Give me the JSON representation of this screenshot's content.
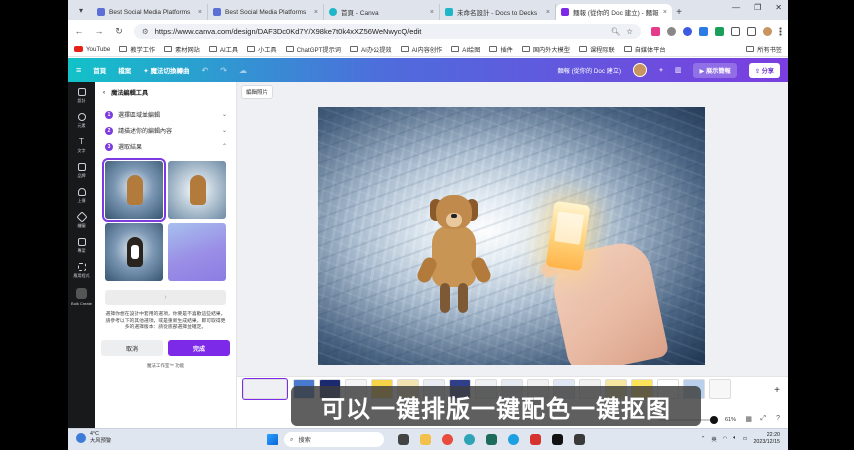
{
  "browser": {
    "tabs": [
      {
        "title": "Best Social Media Platforms",
        "color": "#5b6fd6"
      },
      {
        "title": "Best Social Media Platforms",
        "color": "#5b6fd6"
      },
      {
        "title": "首頁 - Canva",
        "color": "#1fb6c8"
      },
      {
        "title": "未命名設計 - Docs to Decks",
        "color": "#1fb6c8"
      },
      {
        "title": "麵報 (從你的 Doc 建立) - 麵報",
        "color": "#7d2ae8",
        "active": true
      }
    ],
    "url": "https://www.canva.com/design/DAF3Dc0Kd7Y/X98ke7t0k4xXZ56WeNwycQ/edit",
    "bookmarks": [
      "YouTube",
      "教学工作",
      "素材网站",
      "AI工具",
      "小工具",
      "ChatGPT提示词",
      "AI办公提效",
      "AI内容创作",
      "AI绘图",
      "插件",
      "国内外大模型",
      "课程际联",
      "自媒体平台"
    ],
    "bookmarks_right": "所有书签"
  },
  "canva_header": {
    "home": "首頁",
    "file": "檔案",
    "magic_switch": "魔法切換轉曲",
    "doc_title": "麵報 (從你的 Doc 建立)",
    "show_button": "展示簡報",
    "share_button": "分享"
  },
  "rail": [
    "設計",
    "元素",
    "文字",
    "品牌",
    "上傳",
    "繪圖",
    "專案",
    "應用程式",
    "Bulk Create"
  ],
  "panel": {
    "title": "魔法編輯工具",
    "steps": [
      {
        "num": "1",
        "label": "選擇區域並編輯"
      },
      {
        "num": "2",
        "label": "請描述你的編輯內容"
      },
      {
        "num": "3",
        "label": "選取結果"
      }
    ],
    "arrow": "›",
    "note": "選擇你想在設計中套用的選項，你要是不喜歡這些結果，請參考以下的其他選項，或是重新生成結果，即可取得更多的選擇版本：請從底部選擇並確定。",
    "cancel": "取消",
    "done": "完成",
    "footer": "魔法工作室™ 功能"
  },
  "workspace": {
    "edit_tag": "編輯照片"
  },
  "strip": {
    "zoom": "61%",
    "add": "+"
  },
  "caption": "可以一键排版一键配色一键抠图",
  "taskbar": {
    "temp": "4°C",
    "weather": "大风预警",
    "search": "搜索",
    "time": "22:20",
    "date": "2023/12/15",
    "lang": "英"
  }
}
